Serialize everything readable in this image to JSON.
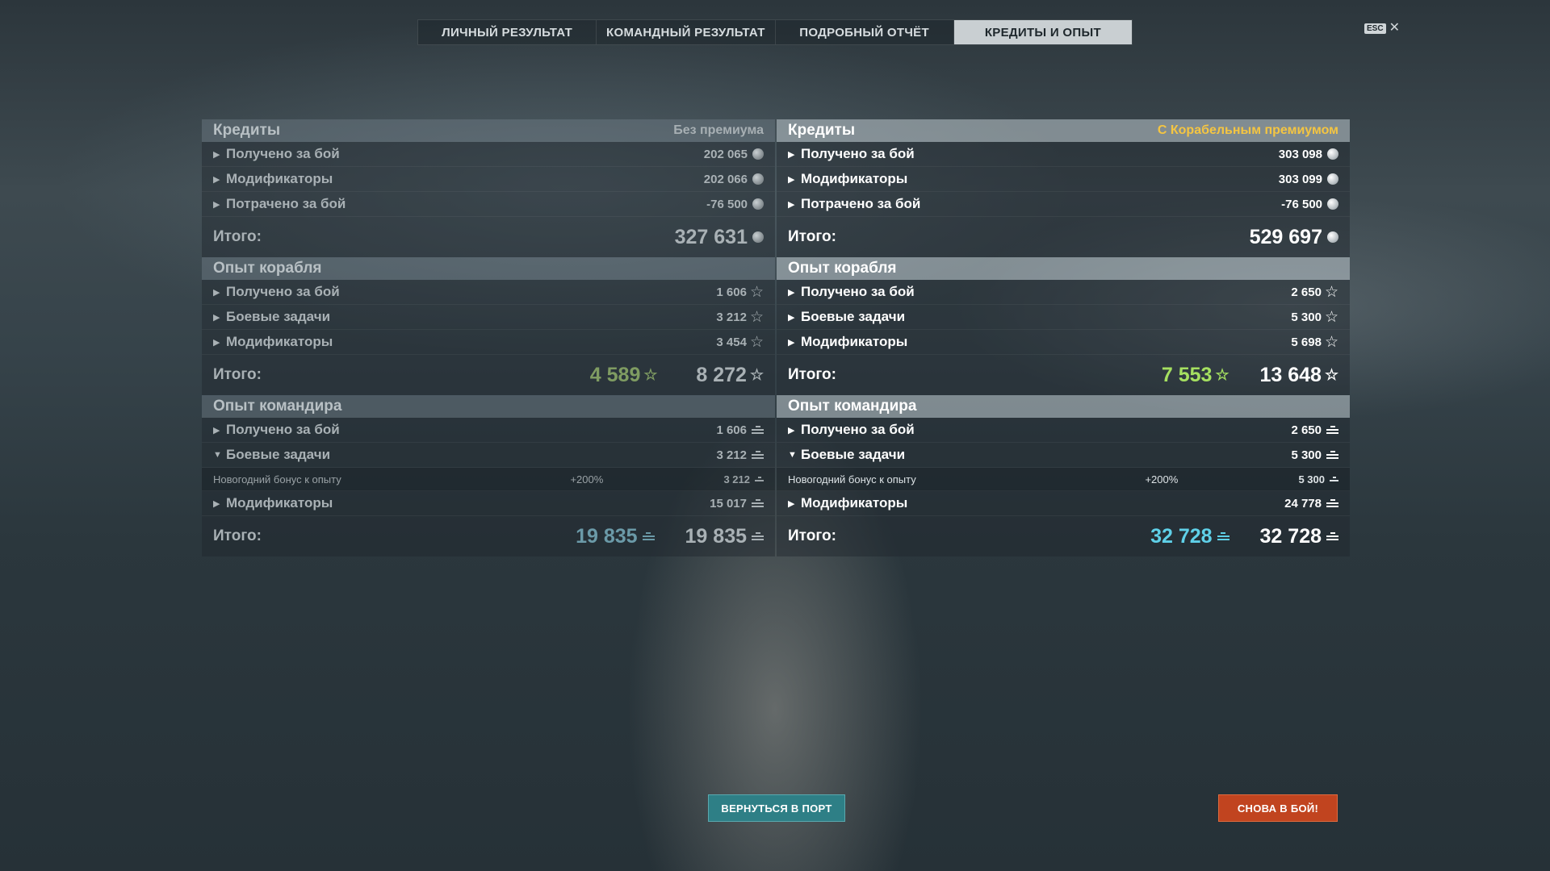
{
  "tabs": [
    {
      "label": "ЛИЧНЫЙ РЕЗУЛЬТАТ"
    },
    {
      "label": "КОМАНДНЫЙ РЕЗУЛЬТАТ"
    },
    {
      "label": "ПОДРОБНЫЙ ОТЧЁТ"
    },
    {
      "label": "КРЕДИТЫ И ОПЫТ"
    }
  ],
  "active_tab": "КРЕДИТЫ И ОПЫТ",
  "esc": {
    "key": "ESC",
    "close": "✕"
  },
  "left": {
    "credits": {
      "title": "Кредиты",
      "note": "Без премиума",
      "rows": [
        {
          "label": "Получено за бой",
          "value": "202 065"
        },
        {
          "label": "Модификаторы",
          "value": "202 066"
        },
        {
          "label": "Потрачено за бой",
          "value": "-76 500"
        }
      ],
      "total_label": "Итого:",
      "total": "327 631"
    },
    "ship_xp": {
      "title": "Опыт корабля",
      "rows": [
        {
          "label": "Получено за бой",
          "value": "1 606"
        },
        {
          "label": "Боевые задачи",
          "value": "3 212"
        },
        {
          "label": "Модификаторы",
          "value": "3 454"
        }
      ],
      "total_label": "Итого:",
      "total_free": "4 589",
      "total": "8 272"
    },
    "commander_xp": {
      "title": "Опыт командира",
      "rows": [
        {
          "label": "Получено за бой",
          "value": "1 606"
        },
        {
          "label": "Боевые задачи",
          "value": "3 212"
        },
        {
          "label": "Модификаторы",
          "value": "15 017"
        }
      ],
      "sub": {
        "label": "Новогодний бонус к опыту",
        "pct": "+200%",
        "value": "3 212"
      },
      "total_label": "Итого:",
      "total_free": "19 835",
      "total": "19 835"
    }
  },
  "right": {
    "credits": {
      "title": "Кредиты",
      "note": "С Корабельным премиумом",
      "rows": [
        {
          "label": "Получено за бой",
          "value": "303 098"
        },
        {
          "label": "Модификаторы",
          "value": "303 099"
        },
        {
          "label": "Потрачено за бой",
          "value": "-76 500"
        }
      ],
      "total_label": "Итого:",
      "total": "529 697"
    },
    "ship_xp": {
      "title": "Опыт корабля",
      "rows": [
        {
          "label": "Получено за бой",
          "value": "2 650"
        },
        {
          "label": "Боевые задачи",
          "value": "5 300"
        },
        {
          "label": "Модификаторы",
          "value": "5 698"
        }
      ],
      "total_label": "Итого:",
      "total_free": "7 553",
      "total": "13 648"
    },
    "commander_xp": {
      "title": "Опыт командира",
      "rows": [
        {
          "label": "Получено за бой",
          "value": "2 650"
        },
        {
          "label": "Боевые задачи",
          "value": "5 300"
        },
        {
          "label": "Модификаторы",
          "value": "24 778"
        }
      ],
      "sub": {
        "label": "Новогодний бонус к опыту",
        "pct": "+200%",
        "value": "5 300"
      },
      "total_label": "Итого:",
      "total_free": "32 728",
      "total": "32 728"
    }
  },
  "buttons": {
    "return_port": "ВЕРНУТЬСЯ В ПОРТ",
    "battle_again": "СНОВА В БОЙ!"
  },
  "colors": {
    "active_tab": "#c9cfd2",
    "premium_note": "#f4c542",
    "free_xp_left": "#7f9c62",
    "free_xp_right": "#a5e060",
    "free_cmd_left": "#6b9aa8",
    "free_cmd_right": "#5fd0e8",
    "port_button": "#2e7f86",
    "battle_button": "#c1441f"
  },
  "icons": {
    "credits": "credit-coin-icon",
    "ship_xp": "star-icon",
    "commander_xp": "commander-xp-icon",
    "collapsed": "caret-right-icon",
    "expanded": "caret-down-icon",
    "close": "close-icon"
  }
}
